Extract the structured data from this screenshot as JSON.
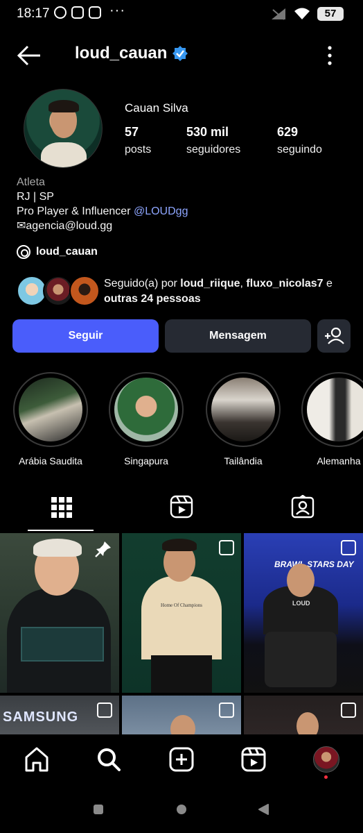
{
  "status_bar": {
    "time": "18:17",
    "battery": "57"
  },
  "header": {
    "username": "loud_cauan"
  },
  "profile": {
    "full_name": "Cauan Silva",
    "stats": [
      {
        "value": "57",
        "label": "posts"
      },
      {
        "value": "530 mil",
        "label": "seguidores"
      },
      {
        "value": "629",
        "label": "seguindo"
      }
    ],
    "bio": {
      "category": "Atleta",
      "line1": "RJ | SP",
      "line2_prefix": "Pro Player & Influencer ",
      "line2_link": "@LOUDgg",
      "line3": "✉agencia@loud.gg"
    },
    "threads_handle": "loud_cauan",
    "mutuals": {
      "prefix": "Seguido(a) por ",
      "user1": "loud_riique",
      "sep": ", ",
      "user2": "fluxo_nicolas7",
      "mid": " e ",
      "rest": "outras 24 pessoas"
    }
  },
  "actions": {
    "follow": "Seguir",
    "message": "Mensagem"
  },
  "highlights": [
    {
      "label": "Arábia Saudita"
    },
    {
      "label": "Singapura"
    },
    {
      "label": "Tailândia"
    },
    {
      "label": "Alemanha"
    }
  ],
  "posts": {
    "thumb_texts": {
      "sponsor": "SAMSUNG",
      "event": "BRAWL STARS DAY",
      "shirt": "Home Of Champions",
      "hoodie": "LOUD"
    }
  },
  "colors": {
    "accent": "#4a5dfb",
    "link": "#8ea6ff",
    "verified": "#3797f0",
    "button_dark": "#262a33"
  },
  "icons": {
    "tabs": [
      "grid-icon",
      "reels-icon",
      "tagged-icon"
    ],
    "nav": [
      "home-icon",
      "search-icon",
      "create-icon",
      "reels-icon",
      "profile-avatar"
    ]
  }
}
